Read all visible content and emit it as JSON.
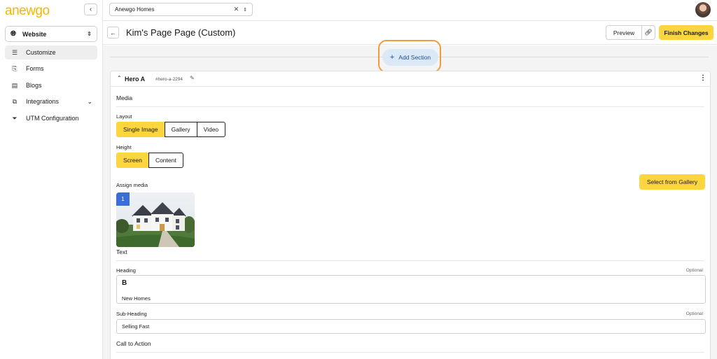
{
  "sidebar": {
    "logo": "anewgo",
    "site_selector": "Website",
    "items": [
      {
        "label": "Customize",
        "icon": "customize-icon"
      },
      {
        "label": "Forms",
        "icon": "forms-icon"
      },
      {
        "label": "Blogs",
        "icon": "blogs-icon"
      },
      {
        "label": "Integrations",
        "icon": "integrations-icon"
      },
      {
        "label": "UTM Configuration",
        "icon": "filter-icon"
      }
    ]
  },
  "topbar": {
    "builder": "Anewgo Homes"
  },
  "page": {
    "title": "Kim's Page Page (Custom)",
    "preview_label": "Preview",
    "finish_label": "Finish Changes",
    "add_section_label": "Add Section"
  },
  "section": {
    "name": "Hero A",
    "anchor": "#hero-a-2294",
    "media_label": "Media",
    "layout_label": "Layout",
    "layout_options": [
      "Single Image",
      "Gallery",
      "Video"
    ],
    "layout_selected": "Single Image",
    "height_label": "Height",
    "height_options": [
      "Screen",
      "Content"
    ],
    "height_selected": "Screen",
    "assign_media_label": "Assign media",
    "select_gallery_label": "Select from Gallery",
    "media_index": "1",
    "text_label": "Text",
    "heading_label": "Heading",
    "heading_optional": "Optional",
    "heading_bold_btn": "B",
    "heading_value": "New Homes",
    "subheading_label": "Sub-Heading",
    "subheading_optional": "Optional",
    "subheading_value": "Selling Fast",
    "cta_label": "Call to Action"
  },
  "colors": {
    "accent": "#fcd53f",
    "highlight_ring": "#f39a3a",
    "add_section_bg": "#dbe9f6",
    "badge": "#3b6fd6"
  }
}
